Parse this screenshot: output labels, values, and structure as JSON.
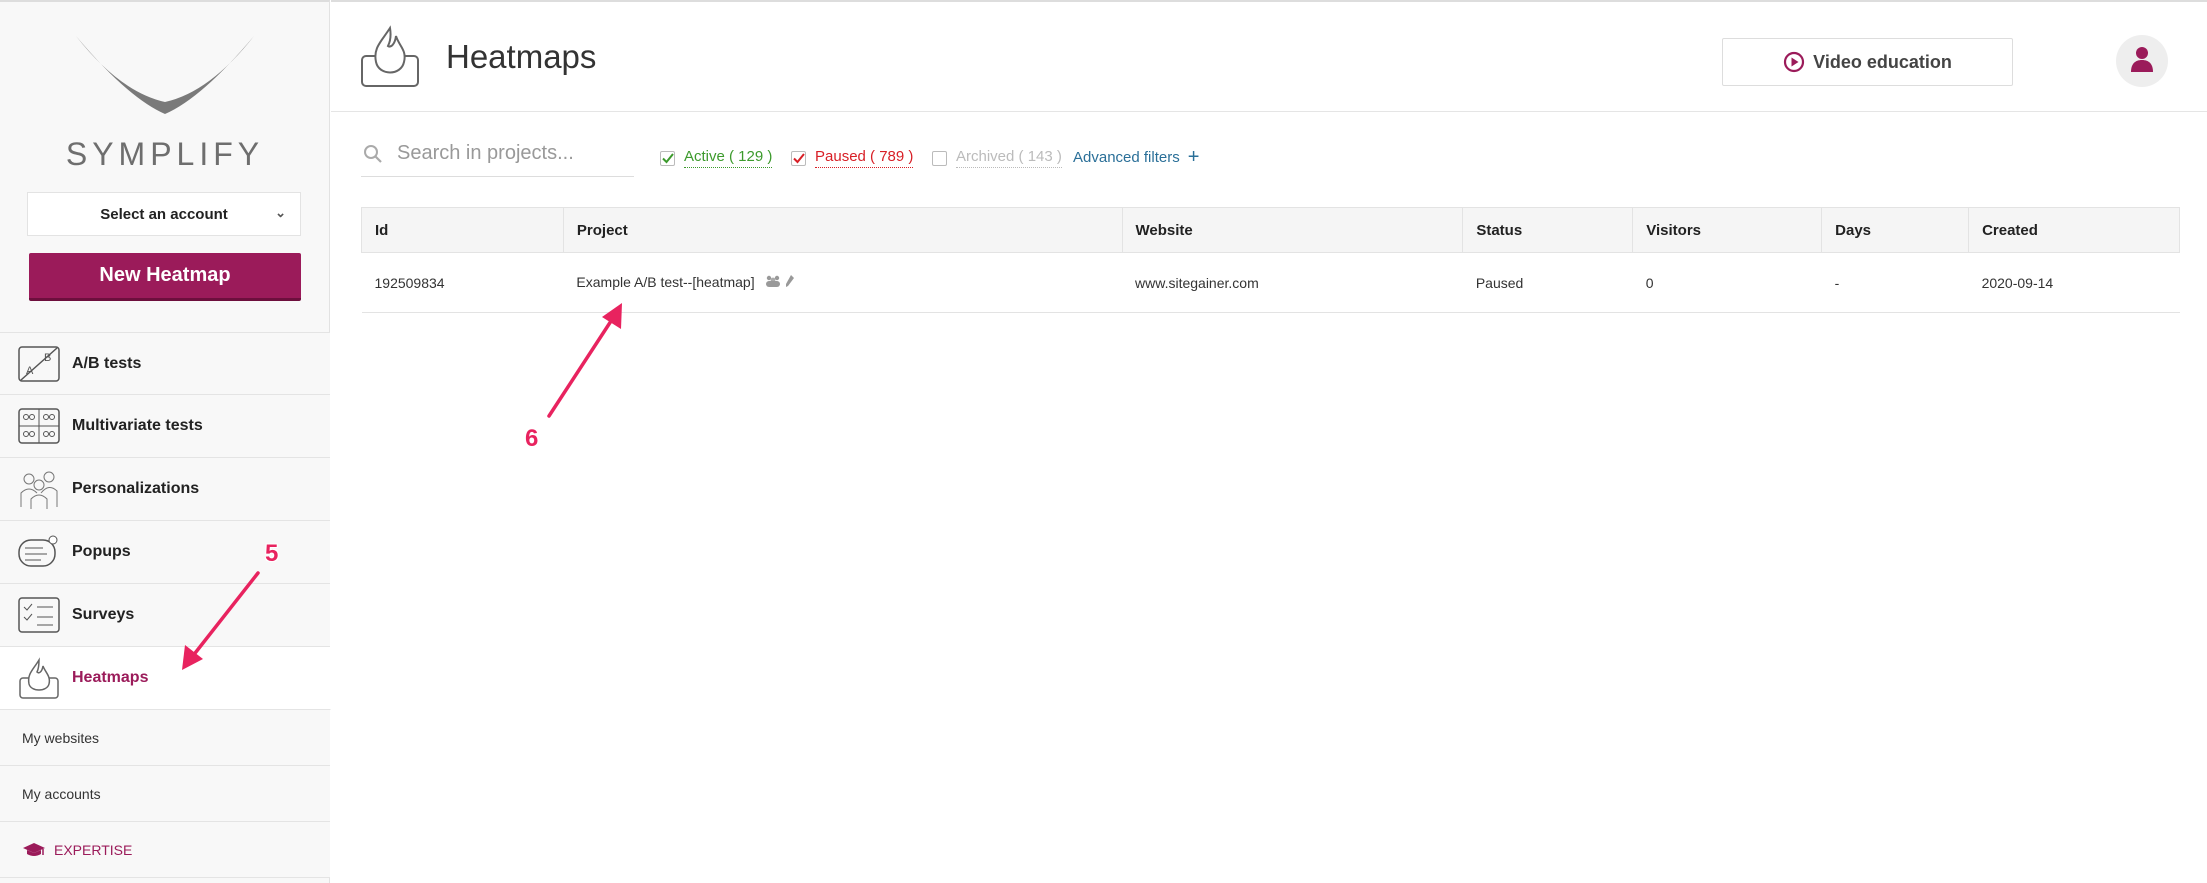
{
  "brand": {
    "name": "SYMPLIFY"
  },
  "sidebar": {
    "account_select": "Select an account",
    "new_button": "New Heatmap",
    "nav": [
      {
        "label": "A/B tests",
        "icon": "ab-test-icon"
      },
      {
        "label": "Multivariate tests",
        "icon": "multivariate-icon"
      },
      {
        "label": "Personalizations",
        "icon": "personalization-icon"
      },
      {
        "label": "Popups",
        "icon": "popup-icon"
      },
      {
        "label": "Surveys",
        "icon": "survey-icon"
      },
      {
        "label": "Heatmaps",
        "icon": "heatmap-flame-icon",
        "active": true
      }
    ],
    "sub": [
      {
        "label": "My websites"
      },
      {
        "label": "My accounts"
      },
      {
        "label": "EXPERTISE",
        "icon": "graduation-cap-icon"
      }
    ]
  },
  "header": {
    "title": "Heatmaps",
    "video_button": "Video education"
  },
  "filters": {
    "search_placeholder": "Search in projects...",
    "active": "Active ( 129 )",
    "paused": "Paused ( 789 )",
    "archived": "Archived ( 143 )",
    "advanced": "Advanced filters",
    "advanced_plus": "+"
  },
  "table": {
    "columns": [
      "Id",
      "Project",
      "Website",
      "Status",
      "Visitors",
      "Days",
      "Created"
    ],
    "rows": [
      [
        "192509834",
        "Example A/B test--[heatmap]",
        "www.sitegainer.com",
        "Paused",
        "0",
        "-",
        "2020-09-14"
      ]
    ]
  },
  "annotations": {
    "step5": "5",
    "step6": "6"
  },
  "colors": {
    "brand": "#9b1b5a",
    "active": "#3c9a2c",
    "paused": "#d81f26",
    "link": "#2a6f98",
    "annotation": "#e8235f"
  }
}
